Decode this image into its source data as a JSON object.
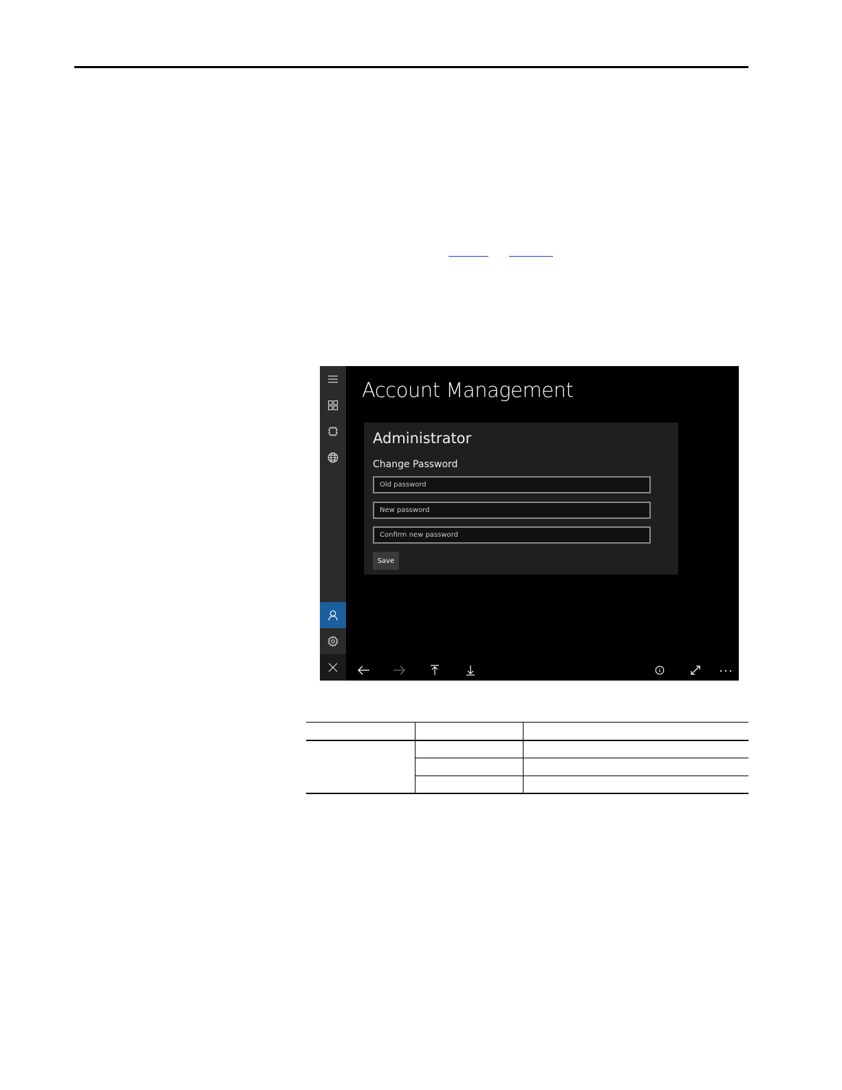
{
  "page": {
    "links": [
      "",
      ""
    ]
  },
  "app": {
    "title": "Account Management",
    "nav_icons": [
      "menu-icon",
      "dashboard-icon",
      "device-icon",
      "globe-icon",
      "account-icon",
      "settings-icon",
      "close-icon"
    ],
    "active_nav": "account-icon",
    "card": {
      "title": "Administrator",
      "section": "Change Password",
      "fields": {
        "old_placeholder": "Old password",
        "new_placeholder": "New password",
        "confirm_placeholder": "Confirm new password"
      },
      "save_label": "Save"
    },
    "command_bar": {
      "left_icons": [
        "back-arrow-icon",
        "forward-arrow-icon",
        "scroll-top-icon",
        "scroll-bottom-icon"
      ],
      "right_icons": [
        "info-icon",
        "fullscreen-icon",
        "more-icon"
      ],
      "colors": {
        "enabled": "#ffffff",
        "disabled": "#6a6a6a"
      }
    },
    "colors": {
      "background": "#000000",
      "rail": "#2b2b2b",
      "accent": "#1b5f9e",
      "card": "#1f1f1f",
      "field_border": "#8a8a8a",
      "button": "#3a3a3a"
    }
  },
  "table": {
    "columns": 3,
    "header_row": [
      "",
      "",
      ""
    ],
    "rows": [
      [
        "",
        "",
        ""
      ],
      [
        "",
        "",
        ""
      ],
      [
        "",
        "",
        ""
      ]
    ]
  }
}
